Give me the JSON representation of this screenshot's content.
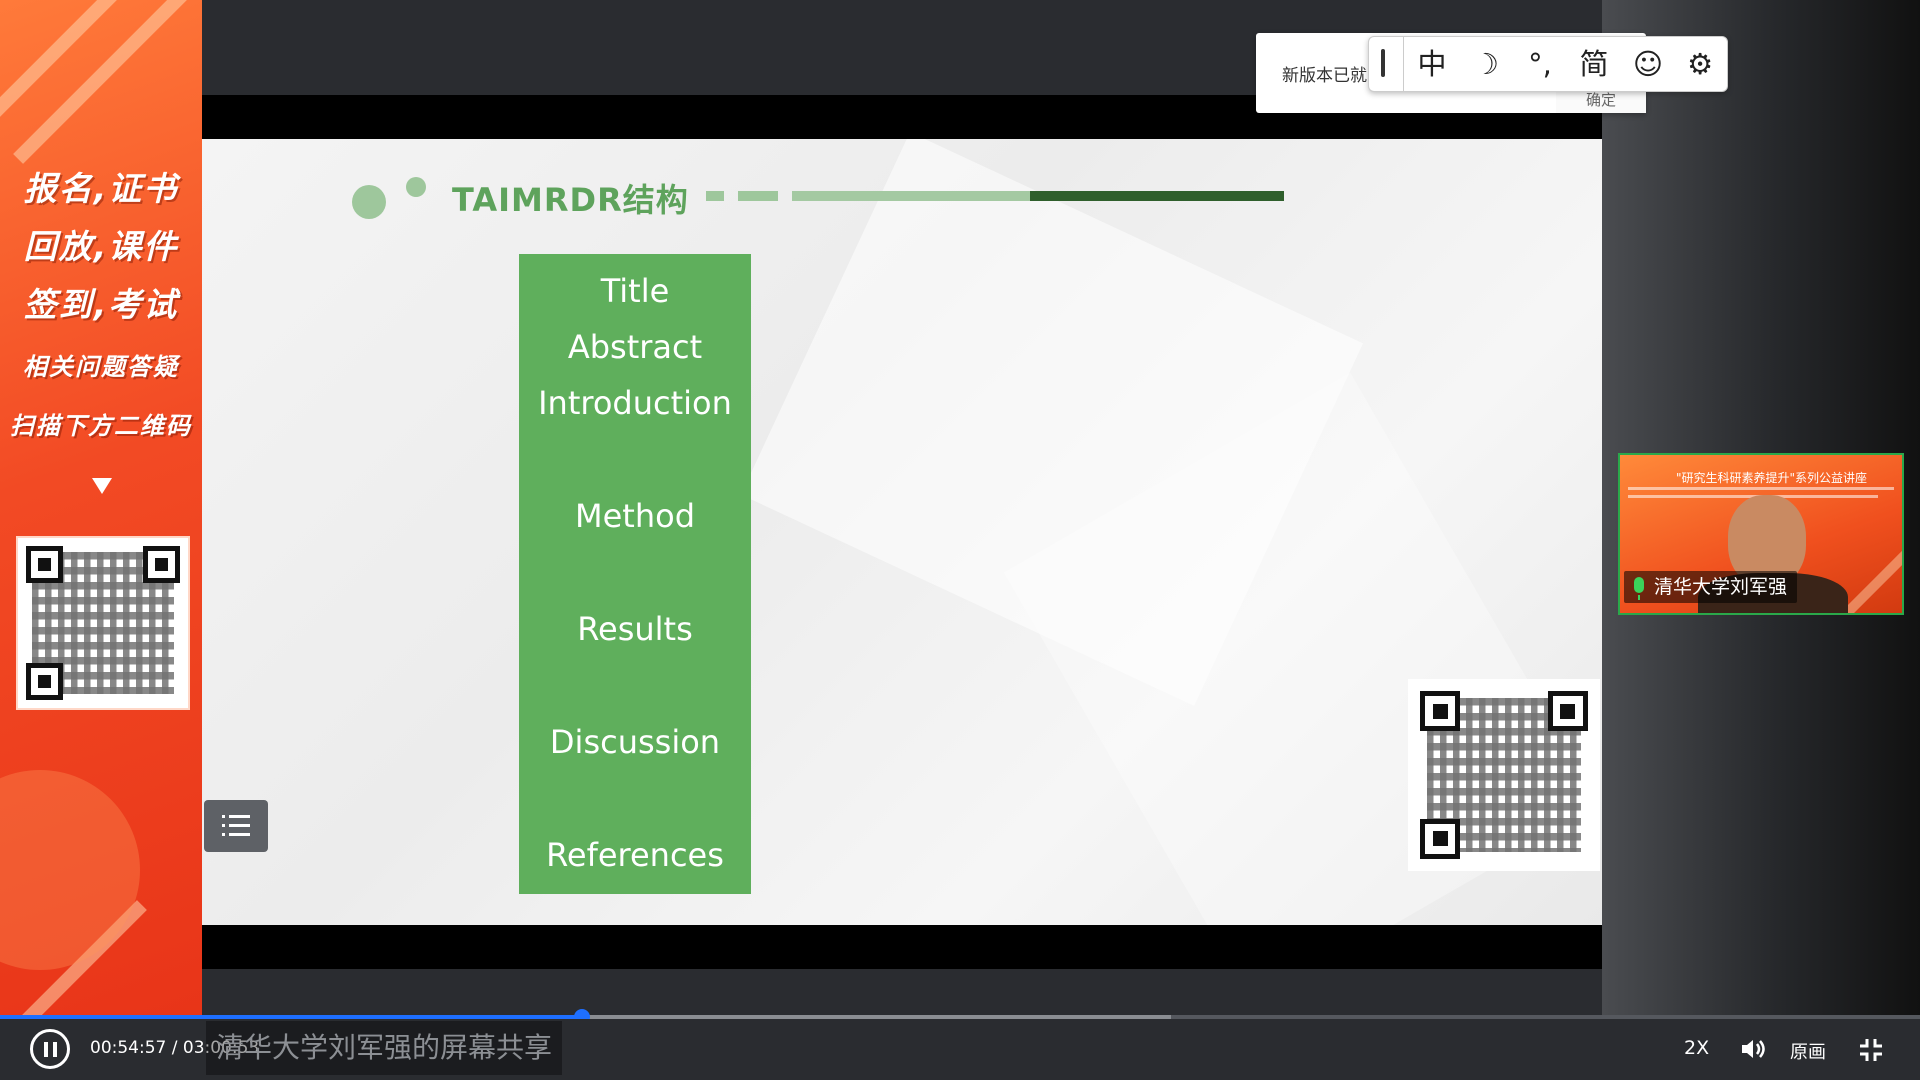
{
  "promo": {
    "line1": "报名,证书",
    "line2": "回放,课件",
    "line3": "签到,考试",
    "line4": "相关问题答疑",
    "line5": "扫描下方二维码"
  },
  "slide": {
    "title": "TAIMRDR结构",
    "sections": [
      "Title",
      "Abstract",
      "Introduction",
      "Method",
      "Results",
      "Discussion",
      "References"
    ],
    "accent_color": "#5faf5c"
  },
  "notice": {
    "text": "新版本已就",
    "ok_label": "确定"
  },
  "ime": {
    "items": [
      "中",
      "☽",
      "°,",
      "简",
      "☺",
      "⚙"
    ]
  },
  "presenter": {
    "banner": "\"研究生科研素养提升\"系列公益讲座",
    "name": "清华大学刘军强"
  },
  "player": {
    "current_time": "00:54:57",
    "total_time": "03:00:53",
    "time_display": "00:54:57 / 03:00:53",
    "progress": 0.303,
    "buffered": 0.61,
    "share_label": "清华大学刘军强的屏幕共享",
    "speed_label": "2X",
    "quality_label": "原画"
  }
}
